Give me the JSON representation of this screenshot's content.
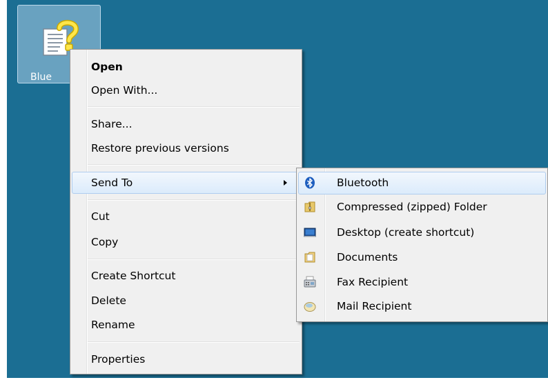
{
  "desktop": {
    "icon": {
      "name": "file-help-icon",
      "label": "Blue"
    }
  },
  "context_menu": {
    "items": [
      {
        "label": "Open",
        "bold": true
      },
      {
        "label": "Open With..."
      },
      {
        "label": "Share..."
      },
      {
        "label": "Restore previous versions"
      },
      {
        "label": "Send To",
        "highlighted": true,
        "has_submenu": true
      },
      {
        "label": "Cut"
      },
      {
        "label": "Copy"
      },
      {
        "label": "Create Shortcut"
      },
      {
        "label": "Delete"
      },
      {
        "label": "Rename"
      },
      {
        "label": "Properties"
      }
    ]
  },
  "send_to_menu": {
    "items": [
      {
        "label": "Bluetooth",
        "icon": "bluetooth-icon",
        "highlighted": true
      },
      {
        "label": "Compressed (zipped) Folder",
        "icon": "zip-folder-icon"
      },
      {
        "label": "Desktop (create shortcut)",
        "icon": "desktop-icon"
      },
      {
        "label": "Documents",
        "icon": "documents-icon"
      },
      {
        "label": "Fax Recipient",
        "icon": "fax-icon"
      },
      {
        "label": "Mail Recipient",
        "icon": "mail-icon"
      }
    ]
  },
  "colors": {
    "desktop_background": "#1b6e93",
    "menu_background": "#f0f0f0",
    "highlight_border": "#aeccef"
  }
}
